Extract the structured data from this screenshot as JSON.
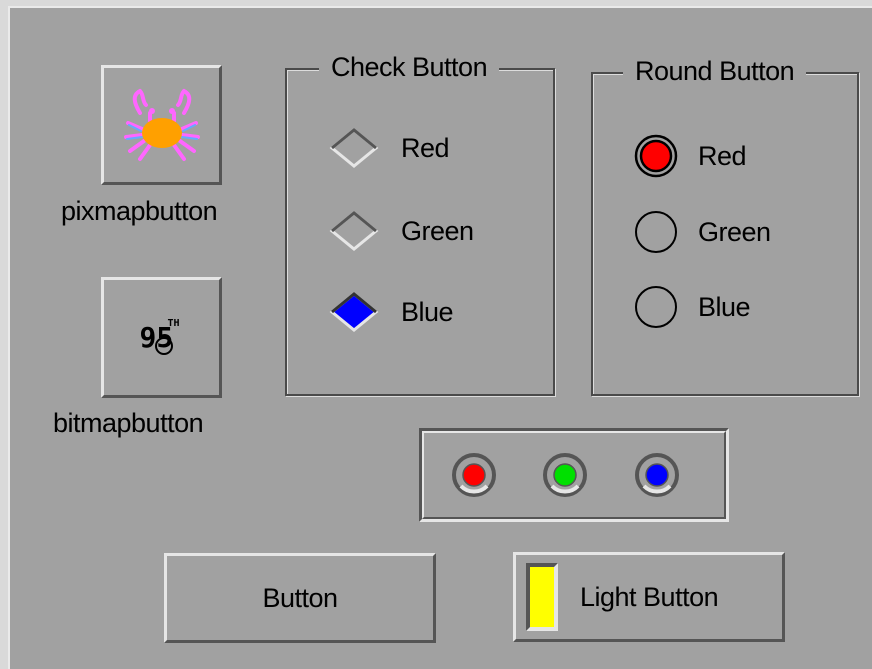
{
  "pixmap_button": {
    "label": "pixmapbutton",
    "icon": "crab-icon"
  },
  "bitmap_button": {
    "label": "bitmapbutton",
    "glyph": "95",
    "superscript": "TH",
    "icon": "bitmap-95th-icon"
  },
  "check_group": {
    "title": "Check Button",
    "items": [
      {
        "label": "Red",
        "checked": false
      },
      {
        "label": "Green",
        "checked": false
      },
      {
        "label": "Blue",
        "checked": true,
        "color": "#0000ff"
      }
    ]
  },
  "round_group": {
    "title": "Round Button",
    "items": [
      {
        "label": "Red",
        "checked": true,
        "color": "#ff0000"
      },
      {
        "label": "Green",
        "checked": false
      },
      {
        "label": "Blue",
        "checked": false
      }
    ]
  },
  "round3d_buttons": [
    {
      "name": "red",
      "color": "#ff0000"
    },
    {
      "name": "green",
      "color": "#00e000"
    },
    {
      "name": "blue",
      "color": "#0000ff"
    }
  ],
  "button": {
    "label": "Button"
  },
  "light_button": {
    "label": "Light Button",
    "light_color": "#ffff00"
  },
  "colors": {
    "background": "#a1a1a1"
  }
}
